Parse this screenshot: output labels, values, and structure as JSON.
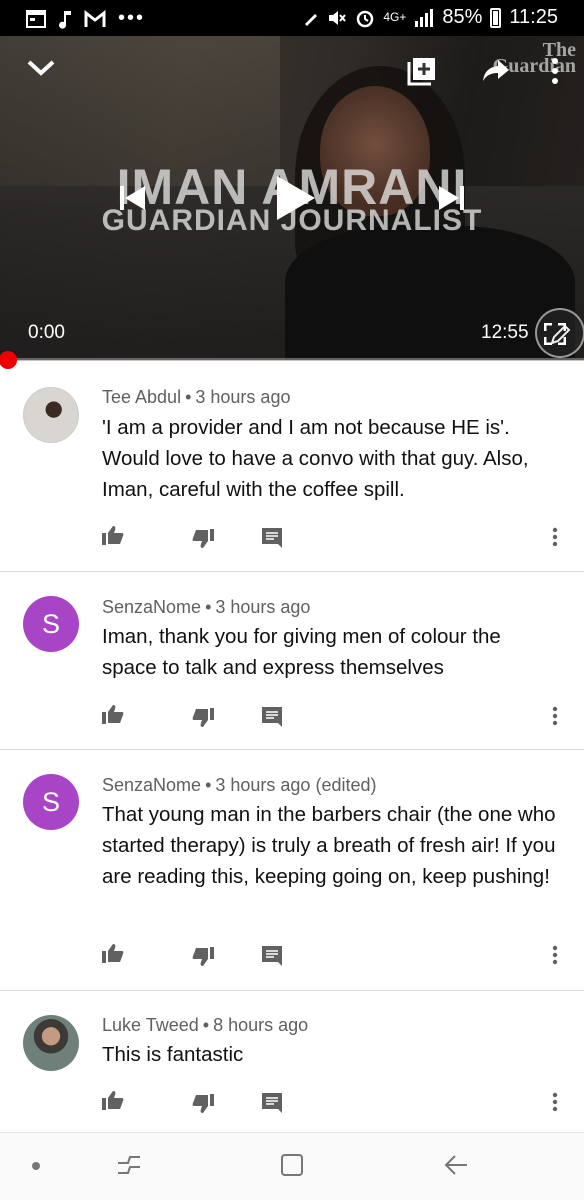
{
  "status_bar": {
    "network": "4G+",
    "battery_percent": "85%",
    "time": "11:25",
    "more": "•••"
  },
  "video": {
    "overlay_title": "IMAN AMRANI",
    "overlay_subtitle": "GUARDIAN JOURNALIST",
    "watermark_line1": "The",
    "watermark_line2": "Guardian",
    "current_time": "0:00",
    "duration": "12:55",
    "progress_fraction": 0.0
  },
  "comments": [
    {
      "author": "Tee Abdul",
      "age": "3 hours ago",
      "edited": "",
      "text": "'I am a provider and I am not because HE is'. Would love to have a convo with that guy. Also, Iman, careful with the coffee spill.",
      "avatar_letter": ""
    },
    {
      "author": "SenzaNome",
      "age": "3 hours ago",
      "edited": "",
      "text": "Iman, thank you for giving men of colour the space to talk and express themselves",
      "avatar_letter": "S"
    },
    {
      "author": "SenzaNome",
      "age": "3 hours ago",
      "edited": "(edited)",
      "text": "That young man in the barbers chair (the one who started therapy) is truly a breath of fresh air! If you are reading this, keeping going on, keep pushing!",
      "avatar_letter": "S"
    },
    {
      "author": "Luke Tweed",
      "age": "8 hours ago",
      "edited": "",
      "text": "This is fantastic",
      "avatar_letter": ""
    }
  ],
  "colors": {
    "avatar_letter_bg": "#a845c7",
    "progress_scrubber": "#e00000"
  }
}
